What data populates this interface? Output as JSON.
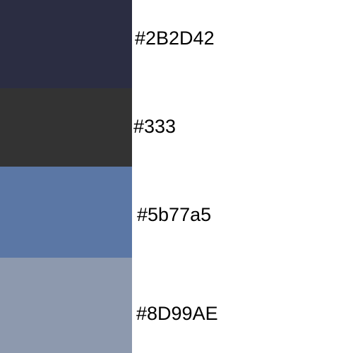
{
  "palette": {
    "swatches": [
      {
        "label": "#2B2D42",
        "color": "#2B2D42"
      },
      {
        "label": "#333",
        "color": "#333333"
      },
      {
        "label": "#5b77a5",
        "color": "#5B77A5"
      },
      {
        "label": "#8D99AE",
        "color": "#8D99AE"
      }
    ]
  }
}
